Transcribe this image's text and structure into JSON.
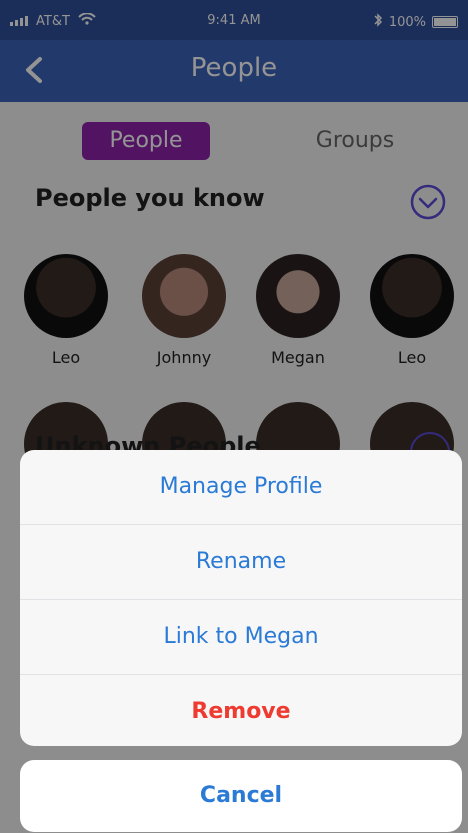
{
  "status_bar": {
    "carrier": "AT&T",
    "time": "9:41 AM",
    "battery": "100%"
  },
  "nav": {
    "title": "People"
  },
  "segments": {
    "active": "People",
    "inactive": "Groups"
  },
  "sections": {
    "people_you_know": "People you know",
    "unknown_people": "Unknown People"
  },
  "people": [
    {
      "name": "Leo"
    },
    {
      "name": "Johnny"
    },
    {
      "name": "Megan"
    },
    {
      "name": "Leo"
    }
  ],
  "action_sheet": {
    "items": [
      {
        "label": "Manage Profile"
      },
      {
        "label": "Rename"
      },
      {
        "label": "Link to Megan"
      },
      {
        "label": "Remove"
      }
    ],
    "cancel": "Cancel"
  },
  "colors": {
    "nav_blue": "#3b62b8",
    "segment_active": "#8e24aa",
    "action_blue": "#2a7ad6",
    "destructive_red": "#ee3a2f"
  },
  "icons": {
    "back": "chevron-left-icon",
    "collapse": "chevron-down-circle-icon",
    "signal": "signal-bars-icon",
    "wifi": "wifi-icon",
    "bluetooth": "bluetooth-icon",
    "battery": "battery-icon"
  }
}
